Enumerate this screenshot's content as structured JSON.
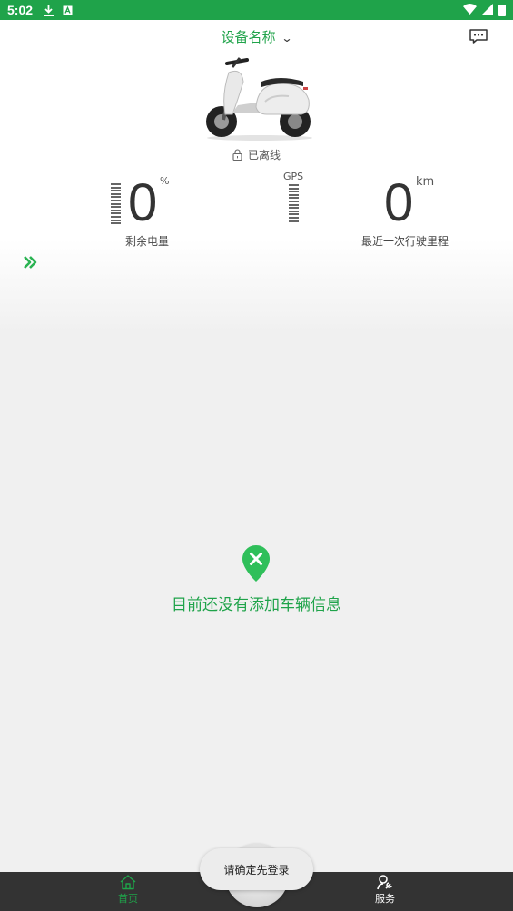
{
  "status_bar": {
    "time": "5:02",
    "icons": [
      "download-icon",
      "a-box-icon",
      "wifi-icon",
      "signal-icon",
      "battery-icon"
    ],
    "background": "#1fa34a"
  },
  "header": {
    "device_name": "设备名称",
    "dropdown_icon": "chevron-down-icon",
    "message_icon": "message-icon"
  },
  "vehicle": {
    "status": "已离线",
    "status_icon": "lock-icon"
  },
  "gauges": {
    "battery": {
      "value": "0",
      "unit": "%",
      "label": "剩余电量"
    },
    "gps": {
      "label": "GPS"
    },
    "mileage": {
      "value": "0",
      "unit": "km",
      "label": "最近一次行驶里程"
    }
  },
  "empty_state": {
    "icon": "location-x-icon",
    "message": "目前还没有添加车辆信息"
  },
  "bottom_nav": {
    "home_label": "首页",
    "service_label": "服务"
  },
  "toast": {
    "message": "请确定先登录"
  },
  "colors": {
    "accent": "#1fa34a",
    "nav_background": "#333333"
  }
}
